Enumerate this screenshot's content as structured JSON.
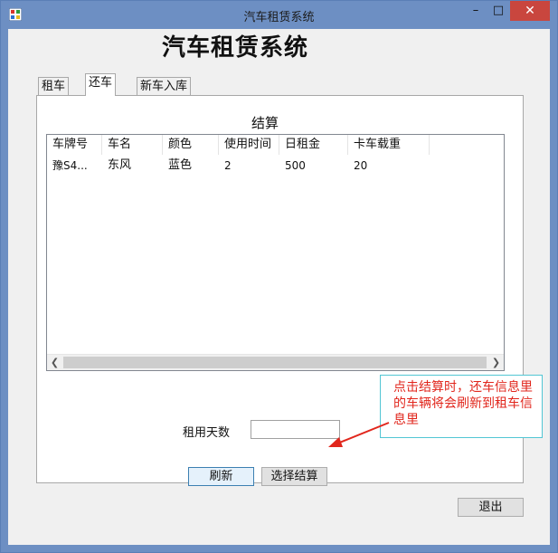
{
  "window": {
    "title": "汽车租赁系统",
    "minimize_glyph": "–",
    "maximize_glyph": "□",
    "close_glyph": "✕",
    "icon": "app-icon"
  },
  "heading": "汽车租赁系统",
  "tabs": [
    {
      "label": "租车",
      "active": false
    },
    {
      "label": "还车",
      "active": true
    },
    {
      "label": "新车入库",
      "active": false
    }
  ],
  "section_title": "结算",
  "listview": {
    "columns": [
      "车牌号",
      "车名",
      "颜色",
      "使用时间",
      "日租金",
      "卡车载重"
    ],
    "rows": [
      [
        "豫S4...",
        "东风",
        "蓝色",
        "2",
        "500",
        "20"
      ]
    ]
  },
  "days_label": "租用天数",
  "days_input_value": "",
  "buttons": {
    "refresh": "刷新",
    "checkout": "选择结算",
    "exit": "退出"
  },
  "annotation": "点击结算时，还车信息里的车辆将会刷新到租车信息里",
  "colors": {
    "titlebar": "#6d8fc3",
    "close": "#c9463e",
    "annotation_text": "#e1261c",
    "annotation_border": "#52c6d4"
  }
}
